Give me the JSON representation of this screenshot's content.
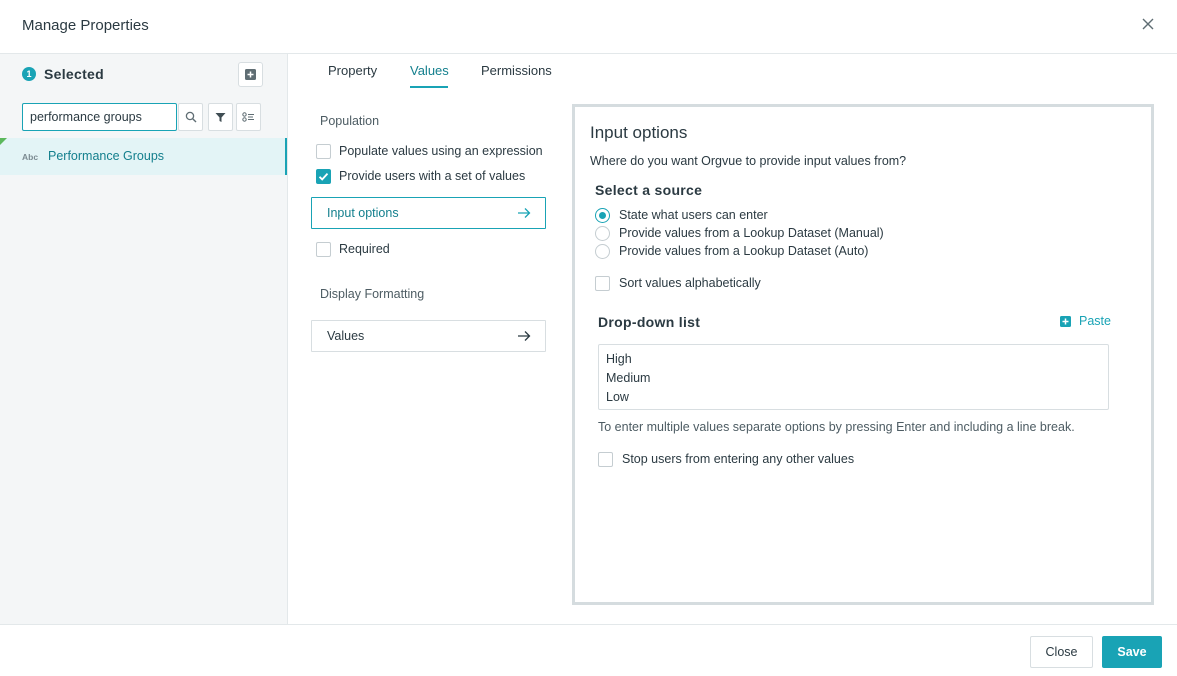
{
  "dialog": {
    "title": "Manage Properties"
  },
  "sidebar": {
    "selected_count": "1",
    "selected_label": "Selected",
    "search": {
      "value": "performance groups"
    },
    "items": [
      {
        "type": "Abc",
        "label": "Performance Groups"
      }
    ]
  },
  "tabs": [
    {
      "label": "Property"
    },
    {
      "label": "Values",
      "active": true
    },
    {
      "label": "Permissions"
    }
  ],
  "population": {
    "heading": "Population",
    "expression_label": "Populate values using an expression",
    "set_of_values_label": "Provide users with a set of values",
    "input_options_label": "Input options",
    "required_label": "Required"
  },
  "display_formatting": {
    "heading": "Display Formatting",
    "values_label": "Values"
  },
  "input_options": {
    "title": "Input options",
    "subtitle": "Where do you want Orgvue to provide input values from?",
    "source_heading": "Select a source",
    "sources": [
      {
        "label": "State what users can enter",
        "selected": true
      },
      {
        "label": "Provide values from a Lookup Dataset (Manual)",
        "selected": false
      },
      {
        "label": "Provide values from a Lookup Dataset (Auto)",
        "selected": false
      }
    ],
    "sort_label": "Sort values alphabetically",
    "dropdown_heading": "Drop-down list",
    "paste_label": "Paste",
    "dropdown_values": [
      "High",
      "Medium",
      "Low"
    ],
    "hint": "To enter multiple values separate options by pressing Enter and including a line break.",
    "stop_label": "Stop users from entering any other values"
  },
  "footer": {
    "close_label": "Close",
    "save_label": "Save"
  },
  "colors": {
    "accent": "#19a3b5",
    "accent_dark": "#137f8d",
    "new_marker": "#5cb85c"
  }
}
